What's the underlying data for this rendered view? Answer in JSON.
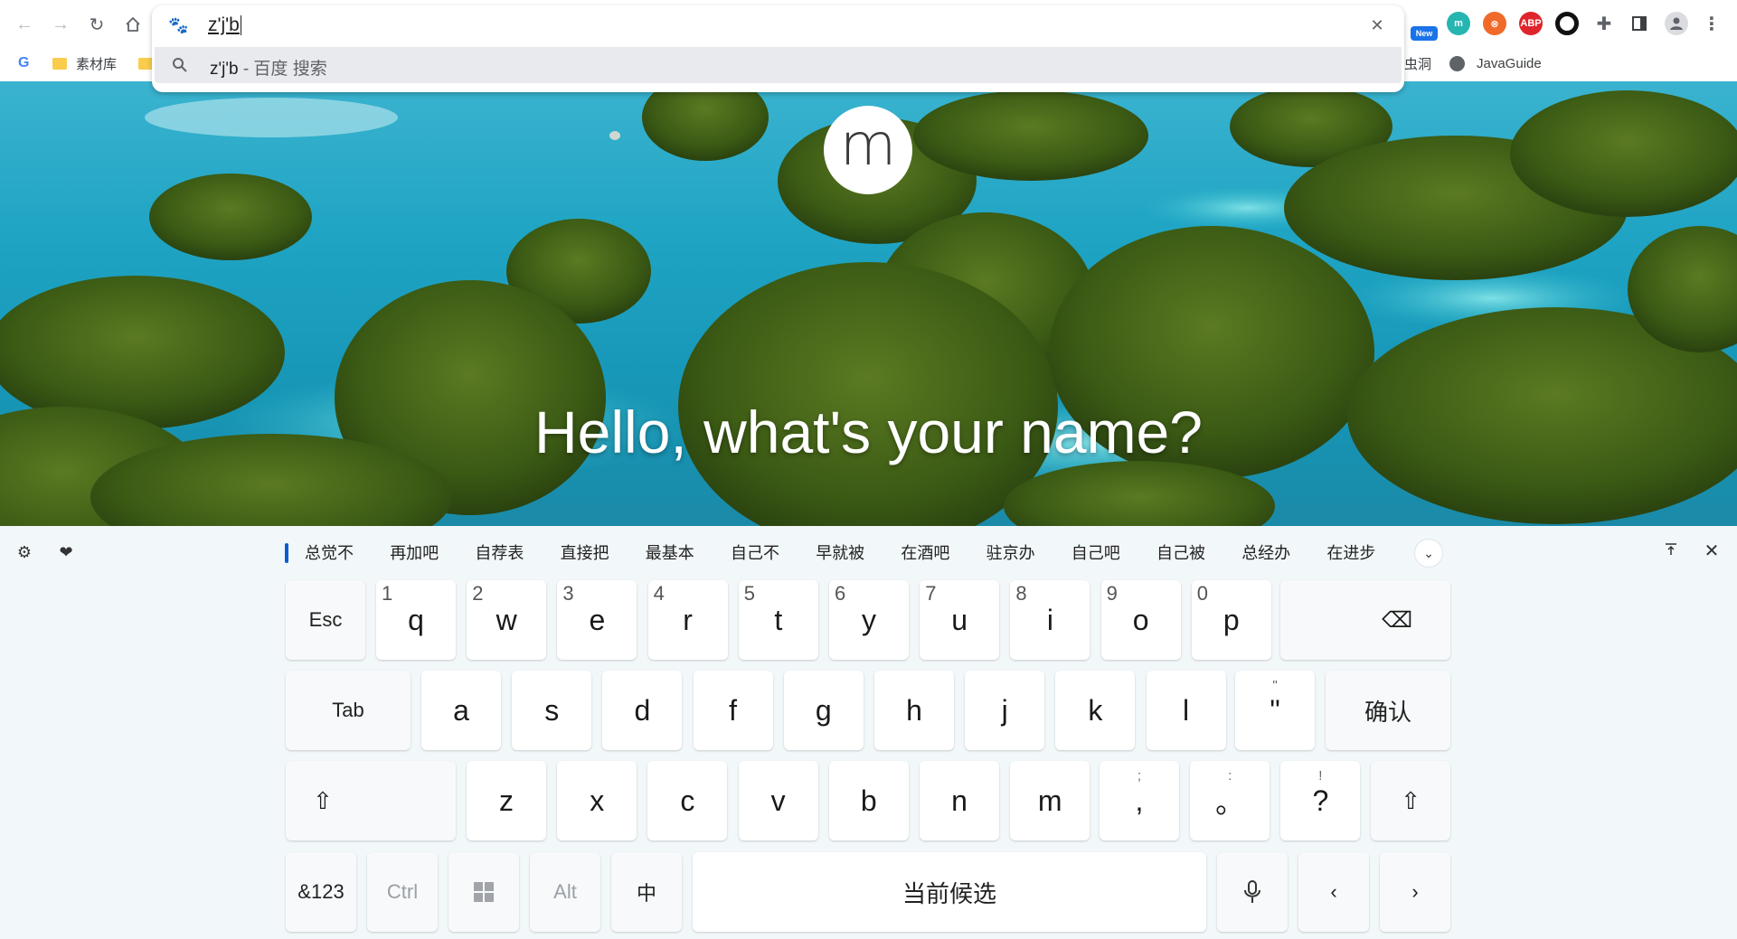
{
  "browser": {
    "omnibox": {
      "typed_text": "z'j'b",
      "suggestion_query": "z'j'b",
      "suggestion_suffix": " - 百度 搜索"
    },
    "extensions": [
      {
        "name": "new-badge-extension",
        "label": "New",
        "color": "#1a73e8"
      },
      {
        "name": "m-extension",
        "label": "m",
        "color": "#26b5b0"
      },
      {
        "name": "orange-extension",
        "label": "⊗",
        "color": "#f06a2a"
      },
      {
        "name": "adblock-plus-extension",
        "label": "ABP",
        "color": "#e0242c"
      },
      {
        "name": "ring-extension",
        "label": "",
        "color": "#111111"
      }
    ],
    "bookmarks": [
      {
        "label": "素材库"
      },
      {
        "label": "虫洞"
      },
      {
        "label": "JavaGuide"
      }
    ]
  },
  "page": {
    "logo_letter": "m",
    "greeting": "Hello, what's your name?"
  },
  "keyboard": {
    "candidates": [
      "总觉不",
      "再加吧",
      "自荐表",
      "直接把",
      "最基本",
      "自己不",
      "早就被",
      "在酒吧",
      "驻京办",
      "自己吧",
      "自己被",
      "总经办",
      "在进步"
    ],
    "row1": [
      {
        "num": "1",
        "char": "q"
      },
      {
        "num": "2",
        "char": "w"
      },
      {
        "num": "3",
        "char": "e"
      },
      {
        "num": "4",
        "char": "r"
      },
      {
        "num": "5",
        "char": "t"
      },
      {
        "num": "6",
        "char": "y"
      },
      {
        "num": "7",
        "char": "u"
      },
      {
        "num": "8",
        "char": "i"
      },
      {
        "num": "9",
        "char": "o"
      },
      {
        "num": "0",
        "char": "p"
      }
    ],
    "row2": [
      "a",
      "s",
      "d",
      "f",
      "g",
      "h",
      "j",
      "k",
      "l"
    ],
    "row3": [
      "z",
      "x",
      "c",
      "v",
      "b",
      "n",
      "m"
    ],
    "labels": {
      "esc": "Esc",
      "tab": "Tab",
      "confirm": "确认",
      "symbols": "&123",
      "ctrl": "Ctrl",
      "alt": "Alt",
      "lang": "中",
      "space": "当前候选"
    },
    "quote_key": {
      "top": "\"",
      "main": "\""
    },
    "comma_key": {
      "top": ";",
      "main": ","
    },
    "period_key": {
      "top": ":",
      "main": "。"
    },
    "question_key": {
      "top": "!",
      "main": "?"
    }
  }
}
